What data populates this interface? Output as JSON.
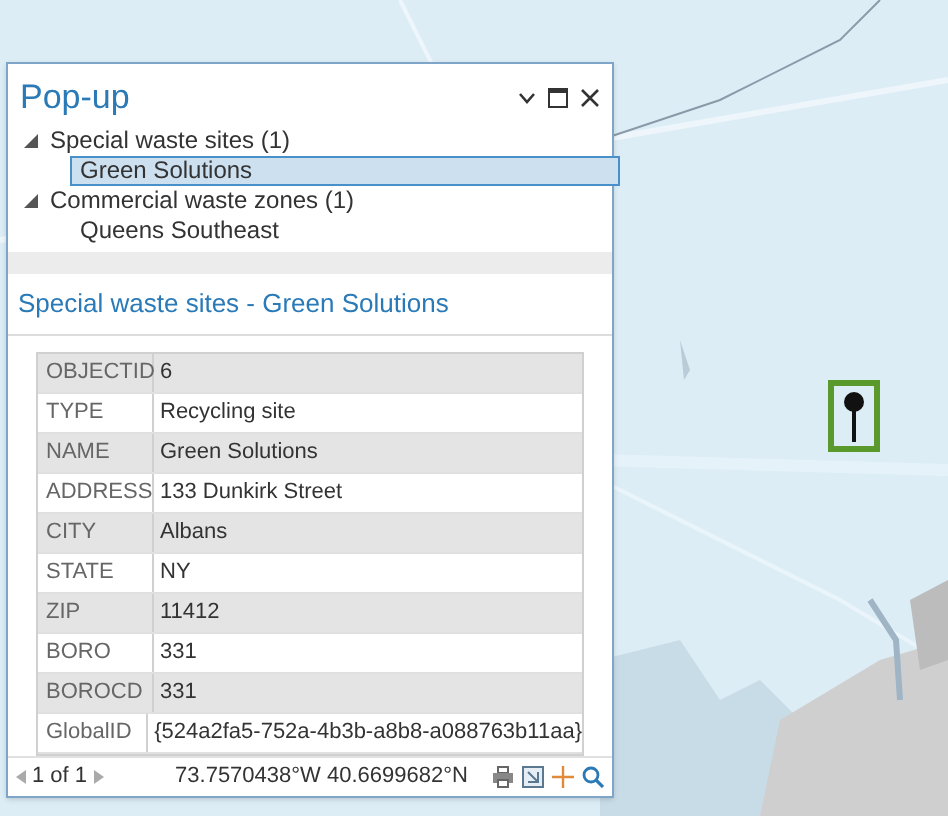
{
  "popup": {
    "title": "Pop-up",
    "tree": [
      {
        "label": "Special waste sites (1)",
        "expanded": true,
        "children": [
          {
            "label": "Green Solutions",
            "selected": true
          }
        ]
      },
      {
        "label": "Commercial waste zones (1)",
        "expanded": true,
        "children": [
          {
            "label": "Queens Southeast",
            "selected": false
          }
        ]
      }
    ],
    "section_title": "Special waste sites - Green Solutions",
    "fields": [
      {
        "name": "OBJECTID",
        "value": "6"
      },
      {
        "name": "TYPE",
        "value": "Recycling site"
      },
      {
        "name": "NAME",
        "value": "Green Solutions"
      },
      {
        "name": "ADDRESS",
        "value": "133 Dunkirk Street"
      },
      {
        "name": "CITY",
        "value": "Albans"
      },
      {
        "name": "STATE",
        "value": "NY"
      },
      {
        "name": "ZIP",
        "value": "11412"
      },
      {
        "name": "BORO",
        "value": "331"
      },
      {
        "name": "BOROCD",
        "value": "331"
      },
      {
        "name": "GlobalID",
        "value": "{524a2fa5-752a-4b3b-a8b8-a088763b11aa}"
      }
    ],
    "pager": "1 of 1",
    "coordinates": "73.7570438°W 40.6699682°N"
  }
}
